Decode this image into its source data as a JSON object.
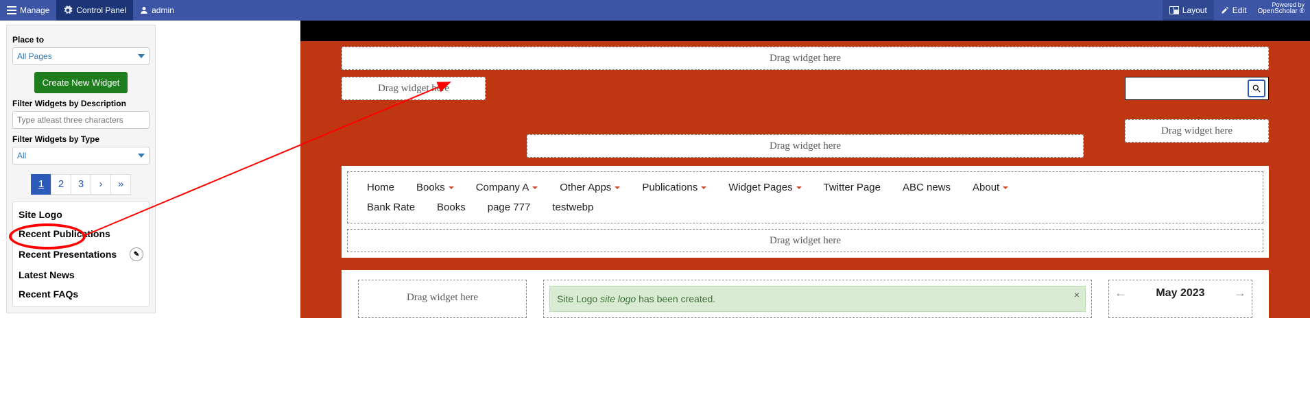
{
  "topbar": {
    "manage": "Manage",
    "control_panel": "Control Panel",
    "admin": "admin",
    "layout": "Layout",
    "edit": "Edit",
    "powered_small": "Powered by",
    "powered": "OpenScholar ®"
  },
  "sidebar": {
    "place_to_label": "Place to",
    "place_to_value": "All Pages",
    "create_btn": "Create New Widget",
    "filter_desc_label": "Filter Widgets by Description",
    "filter_desc_placeholder": "Type atleast three characters",
    "filter_type_label": "Filter Widgets by Type",
    "filter_type_value": "All",
    "pages": [
      "1",
      "2",
      "3",
      "›",
      "»"
    ],
    "active_page": 0,
    "widgets": [
      {
        "label": "Site Logo",
        "editable": false
      },
      {
        "label": "Recent Publications",
        "editable": false
      },
      {
        "label": "Recent Presentations",
        "editable": true
      },
      {
        "label": "Latest News",
        "editable": false
      },
      {
        "label": "Recent FAQs",
        "editable": false
      }
    ]
  },
  "layout": {
    "drag_text": "Drag widget here",
    "nav_row1": [
      {
        "label": "Home",
        "dd": false
      },
      {
        "label": "Books",
        "dd": true
      },
      {
        "label": "Company A",
        "dd": true
      },
      {
        "label": "Other Apps",
        "dd": true
      },
      {
        "label": "Publications",
        "dd": true
      },
      {
        "label": "Widget Pages",
        "dd": true
      },
      {
        "label": "Twitter Page",
        "dd": false
      },
      {
        "label": "ABC news",
        "dd": false
      },
      {
        "label": "About",
        "dd": true
      }
    ],
    "nav_row2": [
      {
        "label": "Bank Rate",
        "dd": false
      },
      {
        "label": "Books",
        "dd": false
      },
      {
        "label": "page 777",
        "dd": false
      },
      {
        "label": "testwebp",
        "dd": false
      }
    ],
    "alert_prefix": "Site Logo ",
    "alert_em": "site logo",
    "alert_suffix": " has been created.",
    "calendar_month": "May 2023"
  }
}
